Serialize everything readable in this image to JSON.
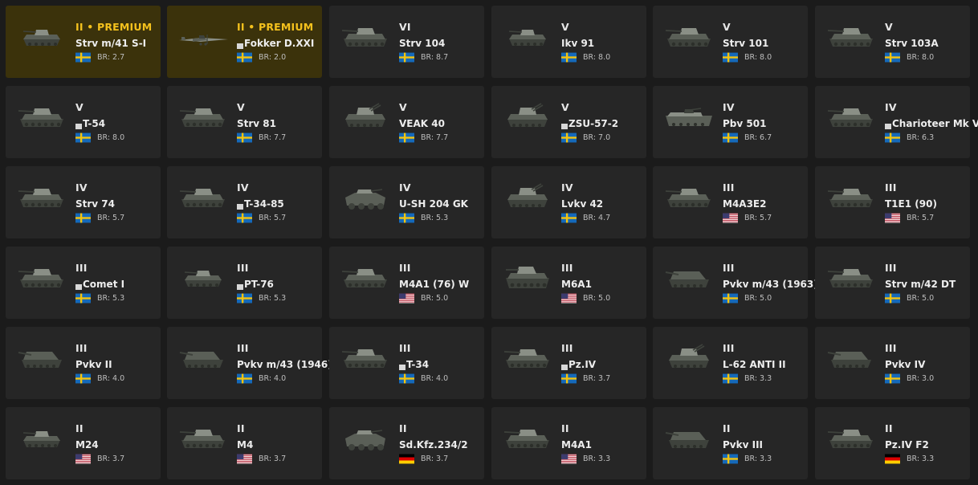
{
  "ui": {
    "br_prefix": "BR: ",
    "colors": {
      "background": "#1b1b1b",
      "card": "#262626",
      "card_premium": "#3b320b",
      "premium_text": "#f4c11d"
    }
  },
  "vehicles": [
    {
      "rank": "II • PREMIUM",
      "name": "Strv m/41 S-I",
      "br": "2.7",
      "flag": "sweden",
      "premium": true,
      "icon": "light-tank-icon",
      "mark": false
    },
    {
      "rank": "II • PREMIUM",
      "name": "Fokker D.XXI",
      "br": "2.0",
      "flag": "sweden",
      "premium": true,
      "icon": "fighter-plane-icon",
      "mark": true
    },
    {
      "rank": "VI",
      "name": "Strv 104",
      "br": "8.7",
      "flag": "sweden",
      "premium": false,
      "icon": "tank-icon",
      "mark": false
    },
    {
      "rank": "V",
      "name": "Ikv 91",
      "br": "8.0",
      "flag": "sweden",
      "premium": false,
      "icon": "light-tank-icon",
      "mark": false
    },
    {
      "rank": "V",
      "name": "Strv 101",
      "br": "8.0",
      "flag": "sweden",
      "premium": false,
      "icon": "tank-icon",
      "mark": false
    },
    {
      "rank": "V",
      "name": "Strv 103A",
      "br": "8.0",
      "flag": "sweden",
      "premium": false,
      "icon": "tank-icon",
      "mark": false
    },
    {
      "rank": "V",
      "name": "T-54",
      "br": "8.0",
      "flag": "sweden",
      "premium": false,
      "icon": "tank-icon",
      "mark": true
    },
    {
      "rank": "V",
      "name": "Strv 81",
      "br": "7.7",
      "flag": "sweden",
      "premium": false,
      "icon": "tank-icon",
      "mark": false
    },
    {
      "rank": "V",
      "name": "VEAK 40",
      "br": "7.7",
      "flag": "sweden",
      "premium": false,
      "icon": "spaa-icon",
      "mark": false
    },
    {
      "rank": "V",
      "name": "ZSU-57-2",
      "br": "7.0",
      "flag": "sweden",
      "premium": false,
      "icon": "spaa-icon",
      "mark": true
    },
    {
      "rank": "IV",
      "name": "Pbv 501",
      "br": "6.7",
      "flag": "sweden",
      "premium": false,
      "icon": "ifv-icon",
      "mark": false
    },
    {
      "rank": "IV",
      "name": "Charioteer Mk VI",
      "br": "6.3",
      "flag": "sweden",
      "premium": false,
      "icon": "tank-icon",
      "mark": true
    },
    {
      "rank": "IV",
      "name": "Strv 74",
      "br": "5.7",
      "flag": "sweden",
      "premium": false,
      "icon": "tank-icon",
      "mark": false
    },
    {
      "rank": "IV",
      "name": "T-34-85",
      "br": "5.7",
      "flag": "sweden",
      "premium": false,
      "icon": "tank-icon",
      "mark": true
    },
    {
      "rank": "IV",
      "name": "U-SH 204 GK",
      "br": "5.3",
      "flag": "sweden",
      "premium": false,
      "icon": "armored-car-icon",
      "mark": false
    },
    {
      "rank": "IV",
      "name": "Lvkv 42",
      "br": "4.7",
      "flag": "sweden",
      "premium": false,
      "icon": "spaa-icon",
      "mark": false
    },
    {
      "rank": "III",
      "name": "M4A3E2",
      "br": "5.7",
      "flag": "usa",
      "premium": false,
      "icon": "tank-icon",
      "mark": false
    },
    {
      "rank": "III",
      "name": "T1E1 (90)",
      "br": "5.7",
      "flag": "usa",
      "premium": false,
      "icon": "tank-icon",
      "mark": false
    },
    {
      "rank": "III",
      "name": "Comet I",
      "br": "5.3",
      "flag": "sweden",
      "premium": false,
      "icon": "tank-icon",
      "mark": true
    },
    {
      "rank": "III",
      "name": "PT-76",
      "br": "5.3",
      "flag": "sweden",
      "premium": false,
      "icon": "light-tank-icon",
      "mark": true
    },
    {
      "rank": "III",
      "name": "M4A1 (76) W",
      "br": "5.0",
      "flag": "usa",
      "premium": false,
      "icon": "tank-icon",
      "mark": false
    },
    {
      "rank": "III",
      "name": "M6A1",
      "br": "5.0",
      "flag": "usa",
      "premium": false,
      "icon": "heavy-tank-icon",
      "mark": false
    },
    {
      "rank": "III",
      "name": "Pvkv m/43 (1963)",
      "br": "5.0",
      "flag": "sweden",
      "premium": false,
      "icon": "tank-destroyer-icon",
      "mark": false
    },
    {
      "rank": "III",
      "name": "Strv m/42 DT",
      "br": "5.0",
      "flag": "sweden",
      "premium": false,
      "icon": "tank-icon",
      "mark": false
    },
    {
      "rank": "III",
      "name": "Pvkv II",
      "br": "4.0",
      "flag": "sweden",
      "premium": false,
      "icon": "tank-destroyer-icon",
      "mark": false
    },
    {
      "rank": "III",
      "name": "Pvkv m/43 (1946)",
      "br": "4.0",
      "flag": "sweden",
      "premium": false,
      "icon": "tank-destroyer-icon",
      "mark": false
    },
    {
      "rank": "III",
      "name": "T-34",
      "br": "4.0",
      "flag": "sweden",
      "premium": false,
      "icon": "tank-icon",
      "mark": true
    },
    {
      "rank": "III",
      "name": "Pz.IV",
      "br": "3.7",
      "flag": "sweden",
      "premium": false,
      "icon": "tank-icon",
      "mark": true
    },
    {
      "rank": "III",
      "name": "L-62 ANTI II",
      "br": "3.3",
      "flag": "sweden",
      "premium": false,
      "icon": "spaa-icon",
      "mark": false
    },
    {
      "rank": "III",
      "name": "Pvkv IV",
      "br": "3.0",
      "flag": "sweden",
      "premium": false,
      "icon": "tank-destroyer-icon",
      "mark": false
    },
    {
      "rank": "II",
      "name": "M24",
      "br": "3.7",
      "flag": "usa",
      "premium": false,
      "icon": "light-tank-icon",
      "mark": false
    },
    {
      "rank": "II",
      "name": "M4",
      "br": "3.7",
      "flag": "usa",
      "premium": false,
      "icon": "tank-icon",
      "mark": false
    },
    {
      "rank": "II",
      "name": "Sd.Kfz.234/2",
      "br": "3.7",
      "flag": "germany",
      "premium": false,
      "icon": "armored-car-icon",
      "mark": false
    },
    {
      "rank": "II",
      "name": "M4A1",
      "br": "3.3",
      "flag": "usa",
      "premium": false,
      "icon": "tank-icon",
      "mark": false
    },
    {
      "rank": "II",
      "name": "Pvkv III",
      "br": "3.3",
      "flag": "sweden",
      "premium": false,
      "icon": "tank-destroyer-icon",
      "mark": false
    },
    {
      "rank": "II",
      "name": "Pz.IV F2",
      "br": "3.3",
      "flag": "germany",
      "premium": false,
      "icon": "tank-icon",
      "mark": false
    }
  ]
}
